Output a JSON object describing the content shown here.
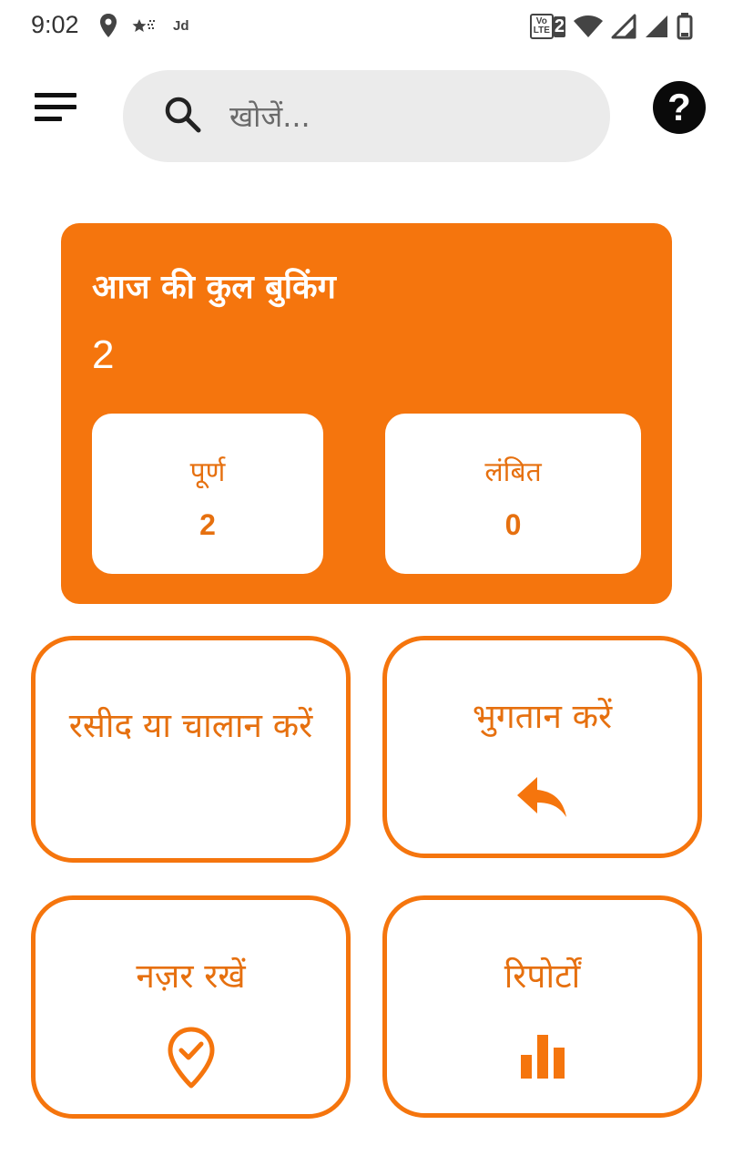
{
  "status_bar": {
    "time": "9:02",
    "carrier_tag": "Jd",
    "volte_top": "Vo",
    "volte_bottom": "LTE",
    "sim_slot": "2",
    "icons": [
      "location-icon",
      "shooting-star-icon",
      "wifi-icon",
      "signal-icon",
      "signal-icon",
      "battery-icon"
    ]
  },
  "app_bar": {
    "menu_icon": "hamburger-menu-icon",
    "search_placeholder": "खोजें...",
    "search_icon": "search-icon",
    "help_glyph": "?"
  },
  "summary": {
    "title": "आज की कुल बुकिंग",
    "total": "2",
    "completed": {
      "label": "पूर्ण",
      "value": "2"
    },
    "pending": {
      "label": "लंबित",
      "value": "0"
    }
  },
  "actions": [
    {
      "label": "रसीद या चालान करें",
      "icon": ""
    },
    {
      "label": "भुगतान करें",
      "icon": "reply-arrow-icon"
    },
    {
      "label": "नज़र रखें",
      "icon": "map-pin-check-icon"
    },
    {
      "label": "रिपोर्टों",
      "icon": "bar-chart-icon"
    }
  ],
  "colors": {
    "accent": "#f5750d",
    "accent_text": "#e6700f",
    "search_bg": "#ebebeb",
    "text_dark": "#111111"
  }
}
